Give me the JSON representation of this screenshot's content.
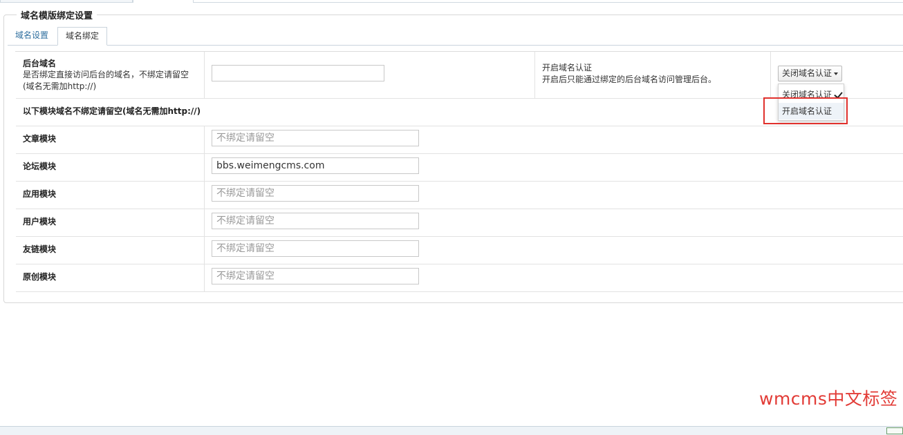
{
  "panel": {
    "title": "域名模版绑定设置"
  },
  "tabs": [
    {
      "label": "域名设置",
      "active": false
    },
    {
      "label": "域名绑定",
      "active": true
    }
  ],
  "admin_domain": {
    "label": "后台域名",
    "desc_line1": "是否绑定直接访问后台的域名，不绑定请留空",
    "desc_line2": "(域名无需加http://)",
    "value": "",
    "auth_title": "开启域名认证",
    "auth_desc": "开启后只能通过绑定的后台域名访问管理后台。"
  },
  "auth_dropdown": {
    "selected": "关闭域名认证",
    "options": [
      {
        "label": "关闭域名认证",
        "checked": true
      },
      {
        "label": "开启域名认证",
        "checked": false
      }
    ],
    "highlight_color": "#e0302c"
  },
  "modules_header": "以下模块域名不绑定请留空(域名无需加http://)",
  "modules": [
    {
      "label": "文章模块",
      "value": "",
      "placeholder": "不绑定请留空"
    },
    {
      "label": "论坛模块",
      "value": "bbs.weimengcms.com",
      "placeholder": "不绑定请留空"
    },
    {
      "label": "应用模块",
      "value": "",
      "placeholder": "不绑定请留空"
    },
    {
      "label": "用户模块",
      "value": "",
      "placeholder": "不绑定请留空"
    },
    {
      "label": "友链模块",
      "value": "",
      "placeholder": "不绑定请留空"
    },
    {
      "label": "原创模块",
      "value": "",
      "placeholder": "不绑定请留空"
    }
  ],
  "watermark": "wmcms中文标签",
  "colors": {
    "link": "#2f6f9f",
    "watermark": "#e23b36"
  }
}
